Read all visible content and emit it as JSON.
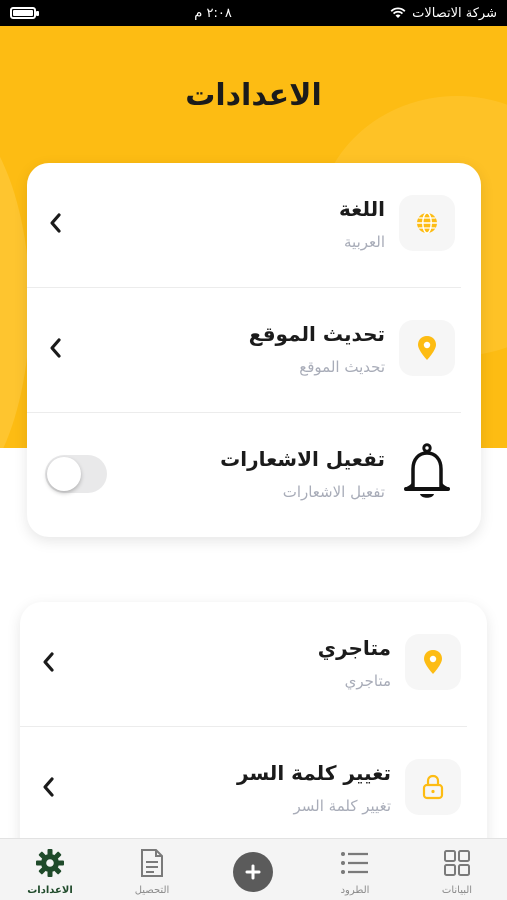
{
  "status_bar": {
    "carrier": "شركة الاتصالات",
    "time": "٢:٠٨ م"
  },
  "page": {
    "title": "الاعدادات"
  },
  "settings_card": {
    "items": [
      {
        "title": "اللغة",
        "subtitle": "العربية",
        "icon": "globe-icon",
        "control": "chevron"
      },
      {
        "title": "تحديث الموقع",
        "subtitle": "تحديث الموقع",
        "icon": "location-pin-icon",
        "control": "chevron"
      },
      {
        "title": "تفعيل الاشعارات",
        "subtitle": "تفعيل الاشعارات",
        "icon": "bell-icon",
        "control": "toggle",
        "toggle_on": false
      }
    ]
  },
  "account_card": {
    "items": [
      {
        "title": "متاجري",
        "subtitle": "متاجري",
        "icon": "location-pin-icon",
        "control": "chevron"
      },
      {
        "title": "تغيير كلمة السر",
        "subtitle": "تغيير كلمة السر",
        "icon": "lock-icon",
        "control": "chevron"
      }
    ]
  },
  "bottom_nav": {
    "items": [
      {
        "label": "البيانات",
        "icon": "grid-icon"
      },
      {
        "label": "الطرود",
        "icon": "list-icon"
      },
      {
        "label": "",
        "icon": "plus-icon"
      },
      {
        "label": "التحصيل",
        "icon": "document-icon"
      },
      {
        "label": "الاعدادات",
        "icon": "gear-icon",
        "active": true
      }
    ]
  },
  "colors": {
    "accent": "#fdbc13",
    "active_nav": "#1f4a2a",
    "subtitle": "#a8acb8"
  }
}
